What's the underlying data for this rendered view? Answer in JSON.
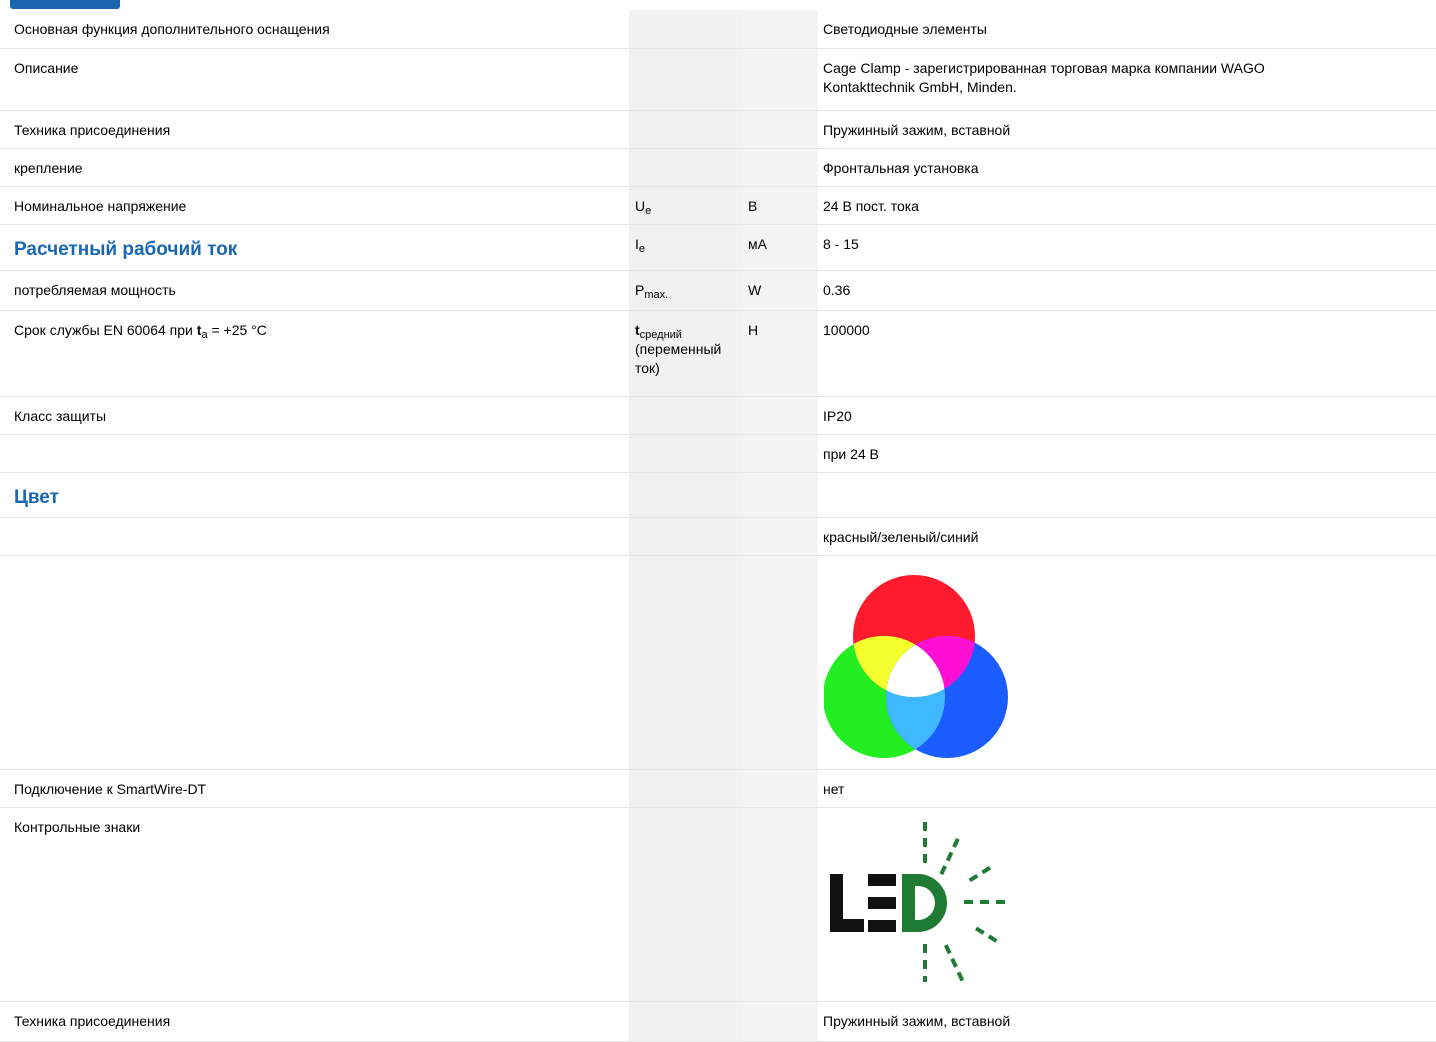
{
  "rows": [
    {
      "label": "Основная функция дополнительного оснащения",
      "value": "Светодиодные элементы"
    },
    {
      "label": "Описание",
      "value_line1": "Cage Clamp - зарегистрированная торговая марка компании WAGO",
      "value_line2": "Kontakttechnik GmbH, Minden."
    },
    {
      "label": "Техника присоединения",
      "value": "Пружинный зажим, вставной"
    },
    {
      "label": "крепление",
      "value": "Фронтальная установка"
    },
    {
      "label": "Номинальное напряжение",
      "symbol": "U",
      "symbol_sub": "e",
      "unit": "В",
      "value": "24 В пост. тока"
    },
    {
      "label": "Расчетный рабочий ток",
      "symbol": "I",
      "symbol_sub": "e",
      "unit": "мА",
      "value": "8 - 15"
    },
    {
      "label": "потребляемая мощность",
      "symbol": "P",
      "symbol_sub": "max.",
      "unit": "W",
      "value": "0.36"
    },
    {
      "label_prefix": "Срок службы EN 60064 при ",
      "label_t": "t",
      "label_t_sub": "a",
      "label_suffix": " = +25 °C",
      "symbol": "t",
      "symbol_sub": "средний",
      "symbol_line2": "(переменный",
      "symbol_line3": "ток)",
      "unit": "H",
      "value": "100000"
    },
    {
      "label": "Класс защиты",
      "value": "IP20"
    },
    {
      "label": "",
      "value": "при 24 В"
    },
    {
      "label": "Цвет",
      "value": ""
    },
    {
      "label": "",
      "value": "красный/зеленый/синий"
    },
    {
      "label": "",
      "image": "rgb-color-mixing-circles"
    },
    {
      "label": "Подключение к SmartWire-DT",
      "value": "нет"
    },
    {
      "label": "Контрольные знаки",
      "image": "led-mark",
      "image_text": "LED"
    },
    {
      "label": "Техника присоединения",
      "value": "Пружинный зажим, вставной"
    }
  ],
  "colors": {
    "heading": "#1967b4",
    "red": "#ff1a2e",
    "green": "#22ee22",
    "blue": "#1a5cff",
    "yellow": "#f5ff2e",
    "magenta": "#ff0fd4",
    "cyan": "#3fb8ff",
    "white": "#ffffff",
    "led_green": "#1f7a33"
  }
}
